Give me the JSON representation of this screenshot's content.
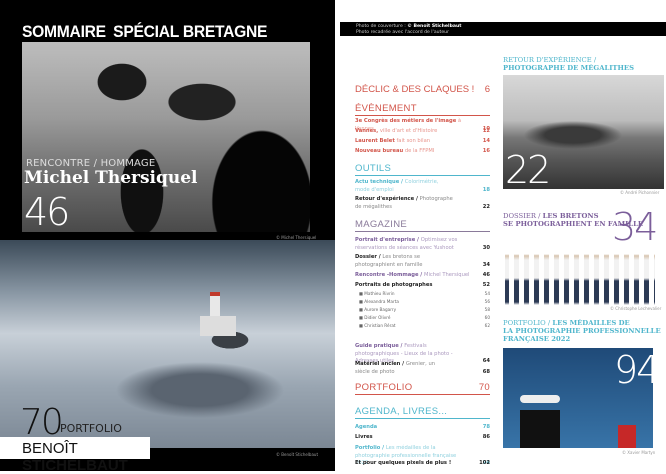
{
  "left": {
    "title_1": "SOMMAIRE",
    "title_2": "SPÉCIAL BRETAGNE",
    "feature": {
      "kicker": "RENCONTRE / HOMMAGE",
      "name": "Michel Thersiquel",
      "page": "46",
      "credit": "© Michel Thersiquel"
    },
    "portfolio": {
      "page": "70",
      "label": "PORTFOLIO",
      "first": "BENOÎT",
      "last": "STICHELBAUT",
      "credit": "© Benoît Stichelbaut"
    }
  },
  "cover": {
    "line1_prefix": "Photo de couverture : ",
    "line1_name": "© Benoît Stichelbaut",
    "line2": "Photo recadrée avec l'accord de l'auteur"
  },
  "toc": {
    "declic": {
      "label": "DÉCLIC & DES CLAQUES !",
      "page": "6"
    },
    "evenement": {
      "label": "ÉVÈNEMENT",
      "items": [
        {
          "b": "3e Congrès des métiers de l'image",
          "r": " à Vannes",
          "p": "10"
        },
        {
          "b": "Vannes,",
          "r": " ville d'art et d'Histoire",
          "p": "12"
        },
        {
          "b": "Laurent Belet",
          "r": " fait son bilan",
          "p": "14"
        },
        {
          "b": "Nouveau bureau",
          "r": " de la FFPMI",
          "p": "16"
        }
      ]
    },
    "outils": {
      "label": "OUTILS",
      "items": [
        {
          "b": "Actu technique / ",
          "r": "Colorimétrie, mode d'emploi",
          "p": "18"
        },
        {
          "b": "Retour d'expérience / ",
          "r": "Photographe de mégalithes",
          "p": "22"
        }
      ]
    },
    "magazine": {
      "label": "MAGAZINE",
      "items": [
        {
          "b": "Portrait d'entreprise / ",
          "r": "Optimisez vos réservations de séances avec Yushoot",
          "p": "30"
        },
        {
          "b": "Dossier / ",
          "r": "Les bretons se photographient en famille",
          "p": "34"
        },
        {
          "b": "Rencontre -Hommage / ",
          "r": "Michel Thersiquel",
          "p": "46"
        },
        {
          "b": "Portraits de photographes",
          "r": "",
          "p": "52"
        },
        {
          "b": "Guide pratique / ",
          "r": "Festivals photographiques - Lieux de la photo - Adresses utiles",
          "p": "64"
        },
        {
          "b": "Matériel ancien / ",
          "r": "Grenier, un siècle de photo",
          "p": "68"
        }
      ],
      "portraits": [
        {
          "n": "Mathieu Rivrin",
          "p": "54"
        },
        {
          "n": "Alexandra Marta",
          "p": "56"
        },
        {
          "n": "Aurore Bagarry",
          "p": "58"
        },
        {
          "n": "Didier Olivré",
          "p": "60"
        },
        {
          "n": "Christian Rérat",
          "p": "62"
        }
      ]
    },
    "portfolio": {
      "label": "PORTFOLIO",
      "page": "70"
    },
    "agenda": {
      "label": "AGENDA, LIVRES...",
      "items": [
        {
          "b": "Agenda",
          "r": "",
          "p": "78"
        },
        {
          "b": "Livres",
          "r": "",
          "p": "86"
        },
        {
          "b": "Portfolio / ",
          "r": "Les médailles de la photographie professionnelle française 2022",
          "p": "94"
        },
        {
          "b": "Et pour quelques pixels de plus !",
          "r": "",
          "p": "102"
        }
      ]
    }
  },
  "right": {
    "f22": {
      "kicker": "RETOUR D'EXPÉRIENCE /",
      "title": "PHOTOGRAPHE DE MÉGALITHES",
      "page": "22",
      "credit": "© André Pichonnier"
    },
    "f34": {
      "kicker": "DOSSIER / ",
      "title_a": "LES BRETONS",
      "title_b": "SE PHOTOGRAPHIENT EN FAMILLE",
      "page": "34",
      "credit": "© Christophe Lechevalier"
    },
    "f94": {
      "kicker": "PORTFOLIO / ",
      "title_a": "LES MÉDAILLES DE",
      "title_b": "LA PHOTOGRAPHIE PROFESSIONNELLE",
      "title_c": "FRANÇAISE 2022",
      "page": "94",
      "credit": "© Xavier Martyn"
    }
  },
  "colors": {
    "red": "#d2554a",
    "teal": "#4fb6cc",
    "purple": "#7b5e9a"
  }
}
